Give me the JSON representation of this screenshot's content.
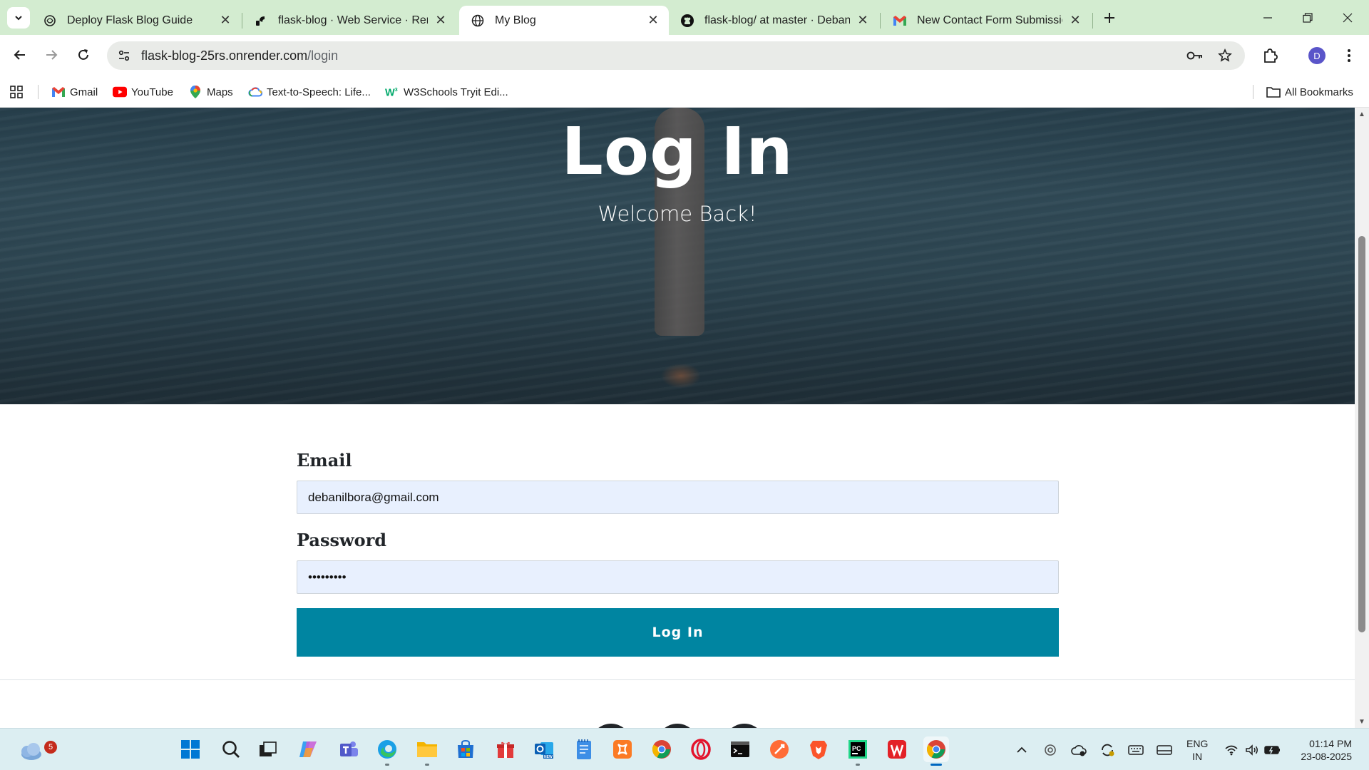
{
  "browser": {
    "tabs": [
      {
        "title": "Deploy Flask Blog Guide",
        "icon": "openai-icon",
        "active": false
      },
      {
        "title": "flask-blog · Web Service · Render",
        "icon": "render-icon",
        "active": false
      },
      {
        "title": "My Blog",
        "icon": "globe-icon",
        "active": true
      },
      {
        "title": "flask-blog/ at master · DebanilBora",
        "icon": "github-icon",
        "active": false
      },
      {
        "title": "New Contact Form Submission",
        "icon": "gmail-icon",
        "active": false
      }
    ],
    "url_host": "flask-blog-25rs.onrender.com",
    "url_path": "/login",
    "profile_initial": "D",
    "bookmarks": [
      {
        "label": "Gmail",
        "icon": "gmail-icon"
      },
      {
        "label": "YouTube",
        "icon": "youtube-icon"
      },
      {
        "label": "Maps",
        "icon": "maps-icon"
      },
      {
        "label": "Text-to-Speech: Life...",
        "icon": "google-cloud-icon"
      },
      {
        "label": "W3Schools Tryit Edi...",
        "icon": "w3schools-icon"
      }
    ],
    "all_bookmarks_label": "All Bookmarks"
  },
  "page": {
    "hero_title": "Log In",
    "hero_subtitle": "Welcome Back!",
    "email_label": "Email",
    "email_value": "debanilbora@gmail.com",
    "password_label": "Password",
    "password_value": "•••••••••",
    "submit_label": "Log In"
  },
  "taskbar": {
    "weather_badge": "5",
    "language": "ENG",
    "region": "IN",
    "time": "01:14 PM",
    "date": "23-08-2025"
  },
  "colors": {
    "accent": "#0085a1",
    "tabstrip": "#d3ecd0",
    "input_bg": "#e8f0fe"
  }
}
